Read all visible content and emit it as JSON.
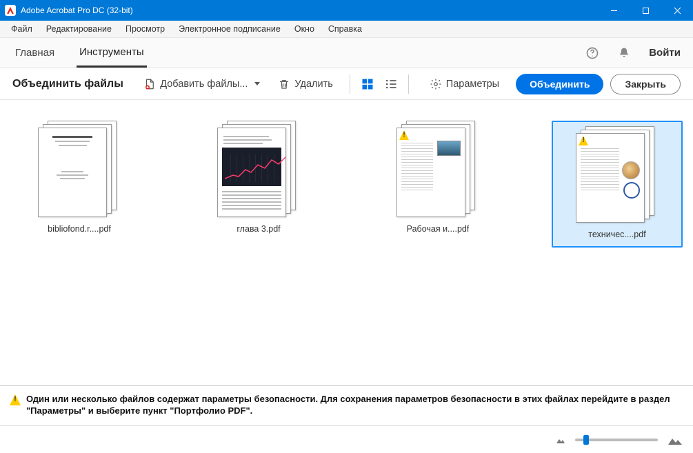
{
  "app": {
    "title": "Adobe Acrobat Pro DC (32-bit)"
  },
  "menu": {
    "items": [
      "Файл",
      "Редактирование",
      "Просмотр",
      "Электронное подписание",
      "Окно",
      "Справка"
    ]
  },
  "header": {
    "tabs": [
      {
        "label": "Главная",
        "active": false
      },
      {
        "label": "Инструменты",
        "active": true
      }
    ],
    "signin": "Войти"
  },
  "toolbar": {
    "title": "Объединить файлы",
    "add": "Добавить файлы...",
    "delete": "Удалить",
    "options": "Параметры",
    "combine": "Объединить",
    "close": "Закрыть"
  },
  "files": [
    {
      "label": "bibliofond.r....pdf",
      "warn": false,
      "kind": "text",
      "selected": false
    },
    {
      "label": "глава 3.pdf",
      "warn": false,
      "kind": "chart",
      "selected": false
    },
    {
      "label": "Рабочая и....pdf",
      "warn": true,
      "kind": "doc-img",
      "selected": false
    },
    {
      "label": "техничес....pdf",
      "warn": true,
      "kind": "doc-photo",
      "selected": true
    }
  ],
  "warning": {
    "text": "Один или несколько файлов содержат параметры безопасности. Для сохранения параметров безопасности в этих файлах перейдите в раздел \"Параметры\" и выберите пункт \"Портфолио PDF\"."
  },
  "right_tools": [
    "create-pdf",
    "export-pdf",
    "organize-pages",
    "edit-pdf",
    "sign",
    "send-for-review",
    "crop",
    "comment",
    "stamp",
    "protect"
  ]
}
